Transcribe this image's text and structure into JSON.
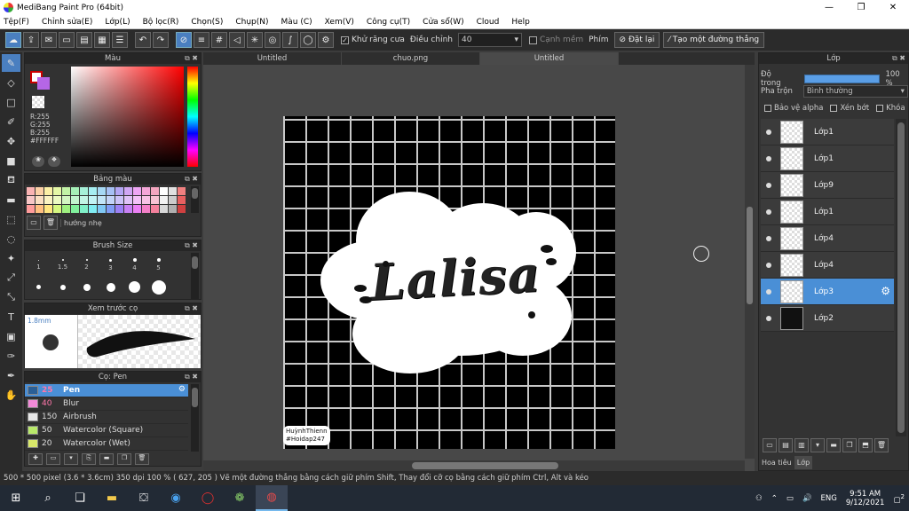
{
  "window": {
    "title": "MediBang Paint Pro (64bit)",
    "controls": [
      "—",
      "❐",
      "✕"
    ]
  },
  "menu": [
    "Tệp(F)",
    "Chỉnh sửa(E)",
    "Lớp(L)",
    "Bộ lọc(R)",
    "Chọn(S)",
    "Chụp(N)",
    "Màu (C)",
    "Xem(V)",
    "Công cụ(T)",
    "Cửa sổ(W)",
    "Cloud",
    "Help"
  ],
  "toolbar": {
    "antialias_label": "Khử răng cưa",
    "adjust_label": "Điều chỉnh",
    "adjust_value": "40",
    "edge_label": "Cạnh mềm",
    "key_label": "Phím",
    "reset_label": "Đặt lại",
    "straight_line_label": "Tạo một đường thẳng"
  },
  "color_panel": {
    "title": "Màu",
    "r": "R:255",
    "g": "G:255",
    "b": "B:255",
    "hex": "#FFFFFF"
  },
  "palette_panel": {
    "title": "Bảng màu",
    "palette_name": "hướng nhẹ",
    "colors": [
      "#f9b3b3",
      "#fbd0a6",
      "#fbf0a6",
      "#e5f7a6",
      "#c2f2a6",
      "#a6f0b8",
      "#a6f0d8",
      "#a6eef2",
      "#a6d8f4",
      "#a6c0f4",
      "#b3a6f4",
      "#d0a6f4",
      "#eea6f4",
      "#f4a6d8",
      "#f4a6c0",
      "#ffffff",
      "#e0e0e0",
      "#f08080",
      "#f7c6c6",
      "#fadfc2",
      "#faf3c2",
      "#ecf9c2",
      "#d3f5c2",
      "#c2f5cf",
      "#c2f5e5",
      "#c2f3f5",
      "#c2e5f7",
      "#c2d3f7",
      "#cbc2f7",
      "#dfc2f7",
      "#f3c2f7",
      "#f7c2e5",
      "#f7c2d3",
      "#f2f2f2",
      "#cccccc",
      "#e86060",
      "#ff9c9c",
      "#ffbf80",
      "#ffe680",
      "#d6f780",
      "#9ff080",
      "#80f09c",
      "#80f0c8",
      "#80ecf2",
      "#80c8f4",
      "#809cf4",
      "#9c80f4",
      "#c880f4",
      "#ec80f4",
      "#f480c8",
      "#f4809c",
      "#d8d8d8",
      "#b0b0b0",
      "#d04040"
    ]
  },
  "brush_size_panel": {
    "title": "Brush Size",
    "sizes": [
      "1",
      "1.5",
      "2",
      "3",
      "4",
      "5",
      "",
      "",
      "",
      "",
      "",
      ""
    ]
  },
  "preview_panel": {
    "title": "Xem trước cọ",
    "size": "1.8mm"
  },
  "brush_panel": {
    "title": "Cọ: Pen",
    "items": [
      {
        "size": "25",
        "name": "Pen",
        "color": "#4a8fd6"
      },
      {
        "size": "40",
        "name": "Blur",
        "color": "#f28ad8"
      },
      {
        "size": "150",
        "name": "Airbrush",
        "color": "#e8e8e8"
      },
      {
        "size": "50",
        "name": "Watercolor (Square)",
        "color": "#b8e86a"
      },
      {
        "size": "20",
        "name": "Watercolor (Wet)",
        "color": "#d8e86a"
      }
    ]
  },
  "tabs": [
    "Untitled",
    "chuo.png",
    "Untitled"
  ],
  "artwork": {
    "text": "Lalisa",
    "watermark_line1": "HuỳnhThienn",
    "watermark_line2": "#Hoidap247"
  },
  "layer_panel": {
    "title": "Lớp",
    "opacity_label": "Độ trong",
    "opacity_value": "100 %",
    "opacity_fraction": 1.0,
    "blend_label": "Pha trộn",
    "blend_value": "Bình thường",
    "protect_alpha": "Bảo vệ alpha",
    "clipping": "Xén bớt",
    "lock": "Khóa",
    "layers": [
      "Lớp1",
      "Lớp1",
      "Lớp9",
      "Lớp1",
      "Lớp4",
      "Lớp4",
      "Lớp3",
      "Lớp2"
    ],
    "tab_material": "Hoa tiêu",
    "tab_layer": "Lớp"
  },
  "status": {
    "text": "500 * 500 pixel  (3.6 * 3.6cm)  350 dpi  100 %  ( 627, 205 )  Vẽ một đường thẳng bằng cách giữ phím Shift, Thay đổi cỡ cọ bằng cách giữ phím Ctrl, Alt và kéo"
  },
  "taskbar": {
    "lang": "ENG",
    "time": "9:51 AM",
    "date": "9/12/2021",
    "notif_count": "2"
  }
}
